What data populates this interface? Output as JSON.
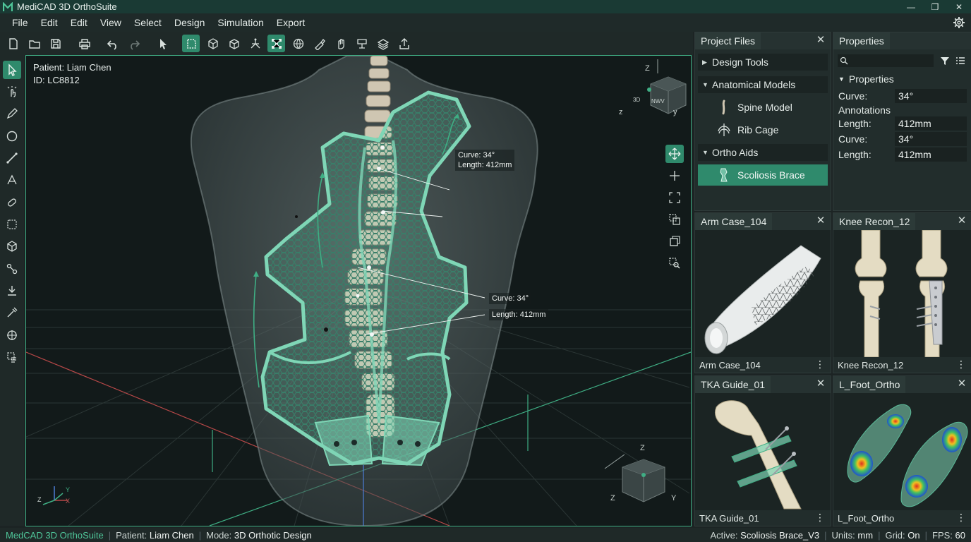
{
  "app": {
    "title": "MediCAD 3D OrthoSuite",
    "window_controls": [
      "—",
      "❐",
      "✕"
    ]
  },
  "menu": [
    "File",
    "Edit",
    "Edit",
    "View",
    "Select",
    "Design",
    "Simulation",
    "Export"
  ],
  "viewport": {
    "patient_line": "Patient: Liam Chen",
    "id_line": "ID: LC8812",
    "annotation_top": {
      "curve": "Curve: 34°",
      "length": "Length: 412mm"
    },
    "annotation_mid": {
      "curve": "Curve: 34°",
      "length": "Length: 412mm"
    },
    "navcube_top": {
      "face": "3D",
      "side": "NWV",
      "z": "Z",
      "x": "z",
      "y": "y"
    },
    "navcube_bottom": {
      "z": "Z",
      "zl": "Z",
      "y": "Y"
    },
    "axis": {
      "x": "X",
      "y": "Y",
      "z": "Z"
    }
  },
  "project_files": {
    "tab": "Project Files",
    "groups": [
      {
        "label": "Design Tools"
      },
      {
        "label": "Anatomical Models",
        "items": [
          "Spine Model",
          "Rib Cage"
        ]
      },
      {
        "label": "Ortho Aids",
        "selected": "Scoliosis Brace"
      }
    ]
  },
  "properties": {
    "tab": "Properties",
    "section": "Properties",
    "rows": [
      {
        "label": "Curve:",
        "value": "34°"
      },
      {
        "label": "Annotations",
        "value": ""
      },
      {
        "label": "Length:",
        "value": "412mm"
      },
      {
        "label": "Curve:",
        "value": "34°"
      },
      {
        "label": "Length:",
        "value": "412mm"
      }
    ]
  },
  "thumbnails": [
    {
      "tab": "Arm Case_104",
      "footer": "Arm Case_104"
    },
    {
      "tab": "Knee Recon_12",
      "footer": "Knee Recon_12"
    },
    {
      "tab": "TKA Guide_01",
      "footer": "TKA Guide_01"
    },
    {
      "tab": "L_Foot_Ortho",
      "footer": "L_Foot_Ortho"
    }
  ],
  "status": {
    "brand": "MedCAD 3D OrthoSuite",
    "patient_label": "Patient:",
    "patient": "Liam Chen",
    "mode_label": "Mode:",
    "mode": "3D Orthotic Design",
    "active_label": "Active:",
    "active": "Scoliosis Brace_V3",
    "units_label": "Units:",
    "units": "mm",
    "grid_label": "Grid:",
    "grid": "On",
    "fps_label": "FPS:",
    "fps": "60"
  },
  "colors": {
    "accent": "#2f8a6c",
    "brace": "#7fd6b6",
    "brand_text": "#4fc79a",
    "viewport_border": "#3fae84"
  }
}
